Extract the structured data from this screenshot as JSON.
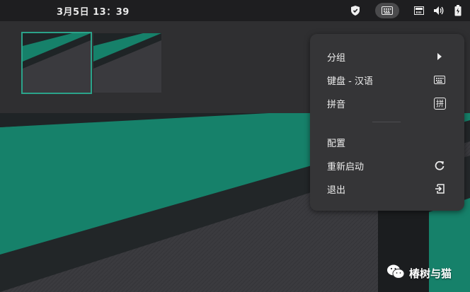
{
  "topbar": {
    "clock": "3月5日  13：39",
    "tray": {
      "shield": "shield-icon",
      "keyboard": "keyboard-icon",
      "network": "network-icon",
      "volume": "volume-icon",
      "battery": "battery-icon"
    }
  },
  "workspaces": [
    {
      "active": true
    },
    {
      "active": false
    }
  ],
  "menu": {
    "items": [
      {
        "label": "分组",
        "icon": "submenu-arrow-icon"
      },
      {
        "label": "键盘 - 汉语",
        "icon": "keyboard-icon"
      },
      {
        "label": "拼音",
        "icon": "pinyin-icon",
        "icon_text": "拼"
      },
      {
        "label": "配置",
        "icon": ""
      },
      {
        "label": "重新启动",
        "icon": "restart-icon"
      },
      {
        "label": "退出",
        "icon": "exit-icon"
      }
    ]
  },
  "watermark": {
    "text": "椿树与猫",
    "icon": "wechat-icon"
  },
  "colors": {
    "accent": "#16816a",
    "topbar": "#1e1e20",
    "menu_bg": "#353537",
    "active_outline": "#2ba38a"
  }
}
